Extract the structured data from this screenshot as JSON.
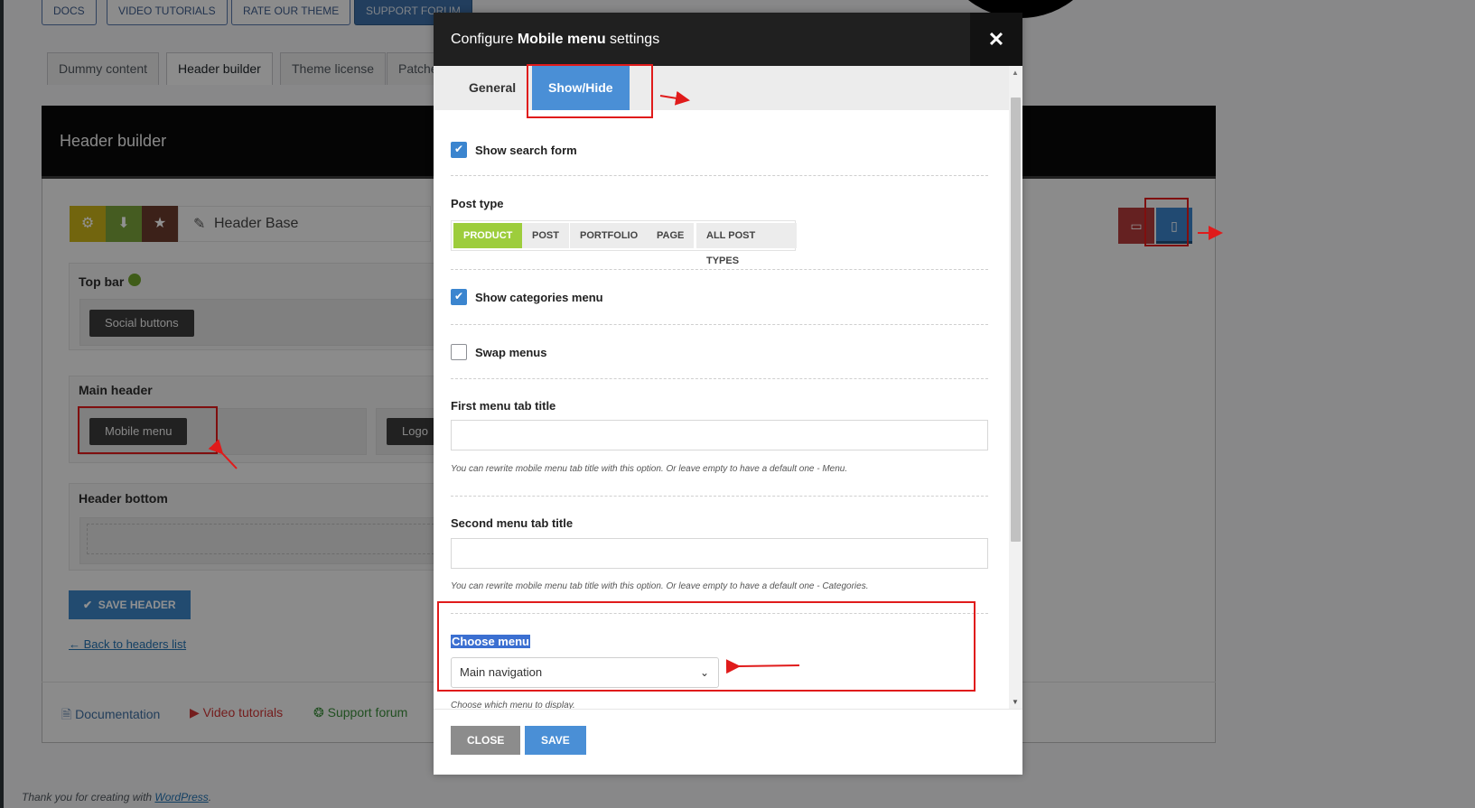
{
  "top_buttons": [
    "DOCS",
    "VIDEO TUTORIALS",
    "RATE OUR THEME",
    "SUPPORT FORUM"
  ],
  "page_tabs": [
    "Dummy content",
    "Header builder",
    "Theme license",
    "Patches"
  ],
  "header_builder": {
    "title": "Header builder",
    "header_name": "Header Base",
    "top_bar_label": "Top bar",
    "social_buttons": "Social buttons",
    "main_header_label": "Main header",
    "mobile_menu": "Mobile menu",
    "logo": "Logo",
    "header_bottom_label": "Header bottom",
    "save_header": "SAVE HEADER",
    "back_link": "← Back to headers list"
  },
  "footer_links": [
    "Documentation",
    "Video tutorials",
    "Support forum"
  ],
  "wp_footer": {
    "text": "Thank you for creating with ",
    "link": "WordPress",
    "end": "."
  },
  "modal": {
    "title_prefix": "Configure ",
    "title_bold": "Mobile menu",
    "title_suffix": " settings",
    "tabs": [
      "General",
      "Show/Hide"
    ],
    "active_tab": "Show/Hide",
    "show_search_form": {
      "label": "Show search form",
      "checked": true
    },
    "post_type": {
      "label": "Post type",
      "options": [
        "PRODUCT",
        "POST",
        "PORTFOLIO",
        "PAGE",
        "ALL POST TYPES"
      ],
      "selected": "PRODUCT"
    },
    "show_categories_menu": {
      "label": "Show categories menu",
      "checked": true
    },
    "swap_menus": {
      "label": "Swap menus",
      "checked": false
    },
    "first_menu_tab_title": {
      "label": "First menu tab title",
      "value": "",
      "hint": "You can rewrite mobile menu tab title with this option. Or leave empty to have a default one - Menu."
    },
    "second_menu_tab_title": {
      "label": "Second menu tab title",
      "value": "",
      "hint": "You can rewrite mobile menu tab title with this option. Or leave empty to have a default one - Categories."
    },
    "choose_menu": {
      "label": "Choose menu",
      "selected": "Main navigation",
      "hint": "Choose which menu to display."
    },
    "close_label": "CLOSE",
    "save_label": "SAVE"
  },
  "colors": {
    "accent_blue": "#4a8fd6",
    "product_green": "#9dcd3c",
    "annotation_red": "#e01b1b"
  }
}
